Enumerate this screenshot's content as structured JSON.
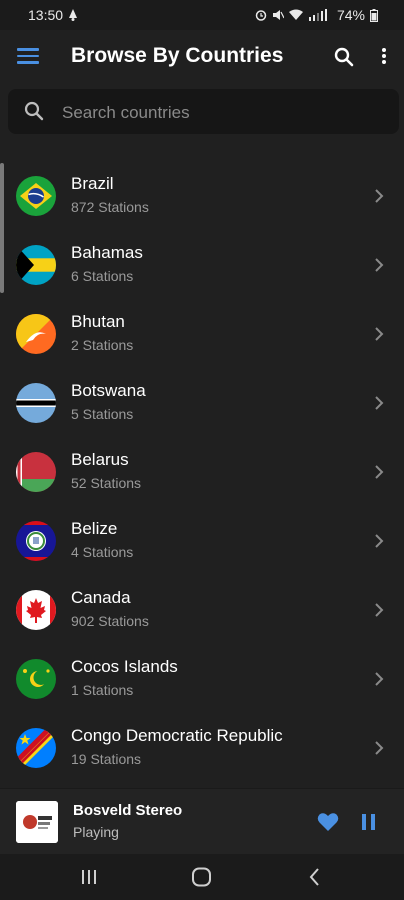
{
  "status_bar": {
    "time": "13:50",
    "battery": "74%"
  },
  "app_bar": {
    "title": "Browse By Countries"
  },
  "search": {
    "placeholder": "Search countries"
  },
  "countries": [
    {
      "name": "Brazil",
      "count": "872 Stations"
    },
    {
      "name": "Bahamas",
      "count": "6 Stations"
    },
    {
      "name": "Bhutan",
      "count": "2 Stations"
    },
    {
      "name": "Botswana",
      "count": "5 Stations"
    },
    {
      "name": "Belarus",
      "count": "52 Stations"
    },
    {
      "name": "Belize",
      "count": "4 Stations"
    },
    {
      "name": "Canada",
      "count": "902 Stations"
    },
    {
      "name": "Cocos Islands",
      "count": "1 Stations"
    },
    {
      "name": "Congo Democratic Republic",
      "count": "19 Stations"
    }
  ],
  "player": {
    "station": "Bosveld Stereo",
    "state": "Playing"
  },
  "colors": {
    "accent": "#4a90e2",
    "background": "#202020",
    "search_bg": "#161616"
  },
  "icons": [
    "menu-icon",
    "search-icon",
    "more-vert-icon",
    "chevron-right-icon",
    "heart-icon",
    "pause-icon",
    "recents-icon",
    "home-icon",
    "back-icon"
  ]
}
